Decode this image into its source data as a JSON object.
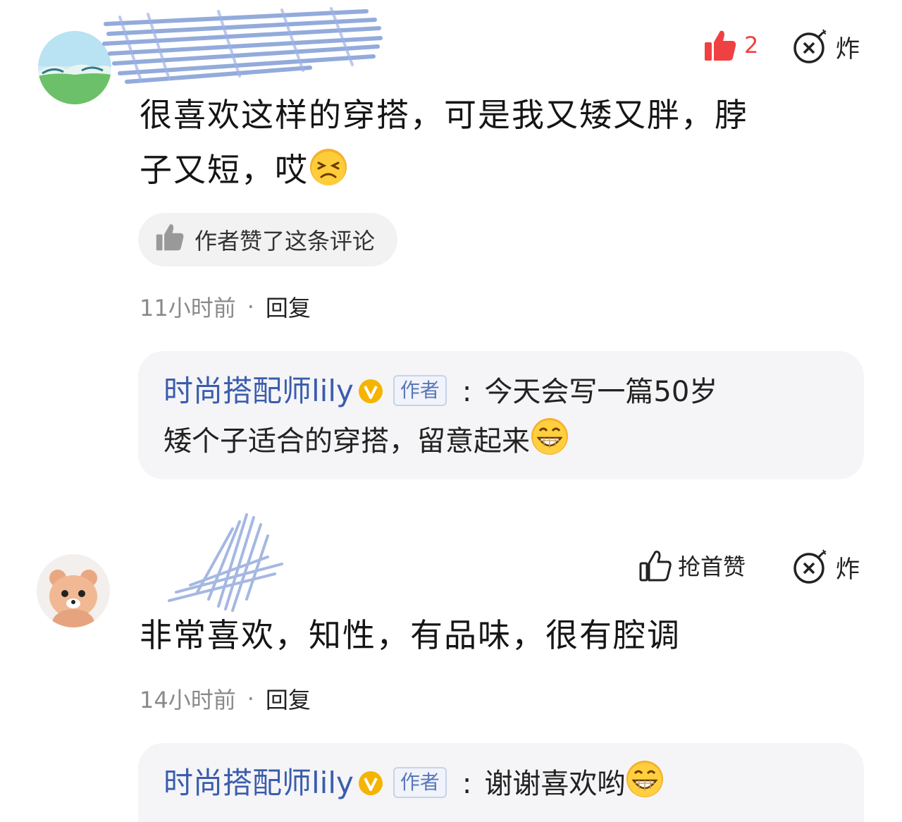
{
  "comments": [
    {
      "likes": {
        "count": "2",
        "icon": "thumbs-up-filled-icon",
        "color": "#f04142"
      },
      "bomb_label": "炸",
      "text": "很喜欢这样的穿搭，可是我又矮又胖，脖子又短，哎",
      "text_line1": "很喜欢这样的穿搭，可是我又矮又胖，脖",
      "text_line2": "子又短，哎",
      "emoji": "frowning-face-emoji",
      "author_liked": "作者赞了这条评论",
      "time": "11小时前",
      "reply_label": "回复",
      "reply": {
        "author": "时尚搭配师lily",
        "tag": "作者",
        "text_line1": "今天会写一篇50岁",
        "text_line2": "矮个子适合的穿搭，留意起来",
        "emoji": "grinning-face-emoji"
      }
    },
    {
      "like_first_label": "抢首赞",
      "bomb_label": "炸",
      "text": "非常喜欢，知性，有品味，很有腔调",
      "time": "14小时前",
      "reply_label": "回复",
      "reply": {
        "author": "时尚搭配师lily",
        "tag": "作者",
        "text_line1": "谢谢喜欢哟",
        "emoji": "grinning-face-emoji"
      }
    }
  ],
  "colors": {
    "author_name": "#3a5dad",
    "like_red": "#f04142",
    "reply_bg": "#f5f5f7",
    "verified_badge": "#f5b400"
  }
}
